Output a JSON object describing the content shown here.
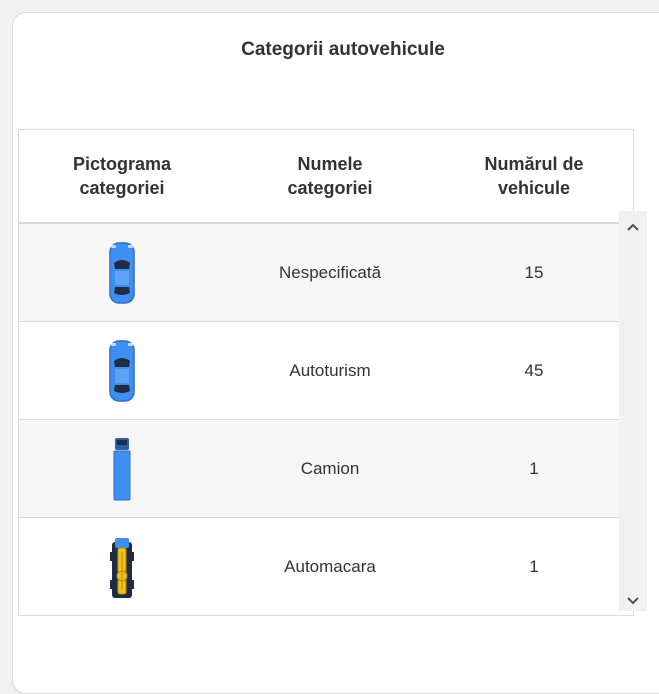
{
  "panel": {
    "title": "Categorii autovehicule"
  },
  "table": {
    "headers": [
      "Pictograma categoriei",
      "Numele categoriei",
      "Numărul de vehicule"
    ],
    "rows": [
      {
        "icon": "car-icon",
        "name": "Nespecificată",
        "count": "15"
      },
      {
        "icon": "car-icon",
        "name": "Autoturism",
        "count": "45"
      },
      {
        "icon": "truck-icon",
        "name": "Camion",
        "count": "1"
      },
      {
        "icon": "crane-truck-icon",
        "name": "Automacara",
        "count": "1"
      }
    ]
  },
  "colors": {
    "vehicle_blue": "#3f8ef2",
    "crane_yellow": "#f2c21b",
    "row_alt": "#f6f6f6"
  },
  "scrollbar": {
    "up_icon": "chevron-up-icon",
    "down_icon": "chevron-down-icon"
  }
}
